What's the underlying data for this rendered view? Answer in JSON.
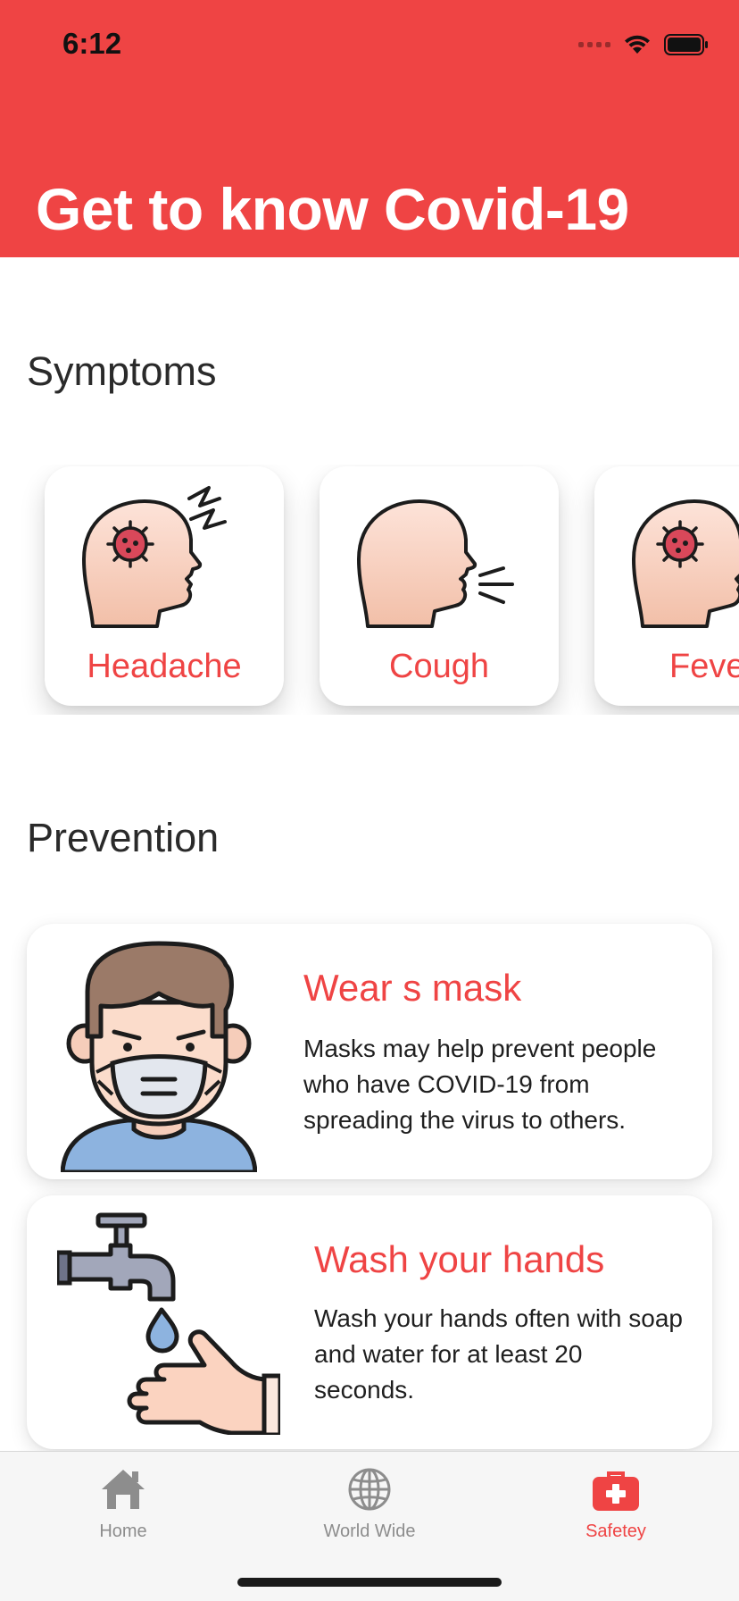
{
  "status_bar": {
    "time": "6:12",
    "wifi_icon": "wifi-icon",
    "battery_icon": "battery-icon"
  },
  "header": {
    "title": "Get to know Covid-19",
    "color": "#EF4444"
  },
  "symptoms": {
    "title": "Symptoms",
    "items": [
      {
        "label": "Headache",
        "icon": "headache-icon"
      },
      {
        "label": "Cough",
        "icon": "cough-icon"
      },
      {
        "label": "Feve",
        "icon": "fever-icon"
      }
    ]
  },
  "prevention": {
    "title": "Prevention",
    "items": [
      {
        "title": "Wear s mask",
        "description": "Masks may help prevent people who have COVID-19 from spreading the virus to others.",
        "icon": "mask-person-icon"
      },
      {
        "title": "Wash your hands",
        "description": "Wash your hands often with soap and water for at least 20 seconds.",
        "icon": "hand-wash-icon"
      }
    ]
  },
  "tab_bar": {
    "active": "Safetey",
    "tabs": [
      {
        "label": "Home",
        "icon": "home-icon"
      },
      {
        "label": "World Wide",
        "icon": "globe-icon"
      },
      {
        "label": "Safetey",
        "icon": "first-aid-kit-icon"
      }
    ]
  }
}
